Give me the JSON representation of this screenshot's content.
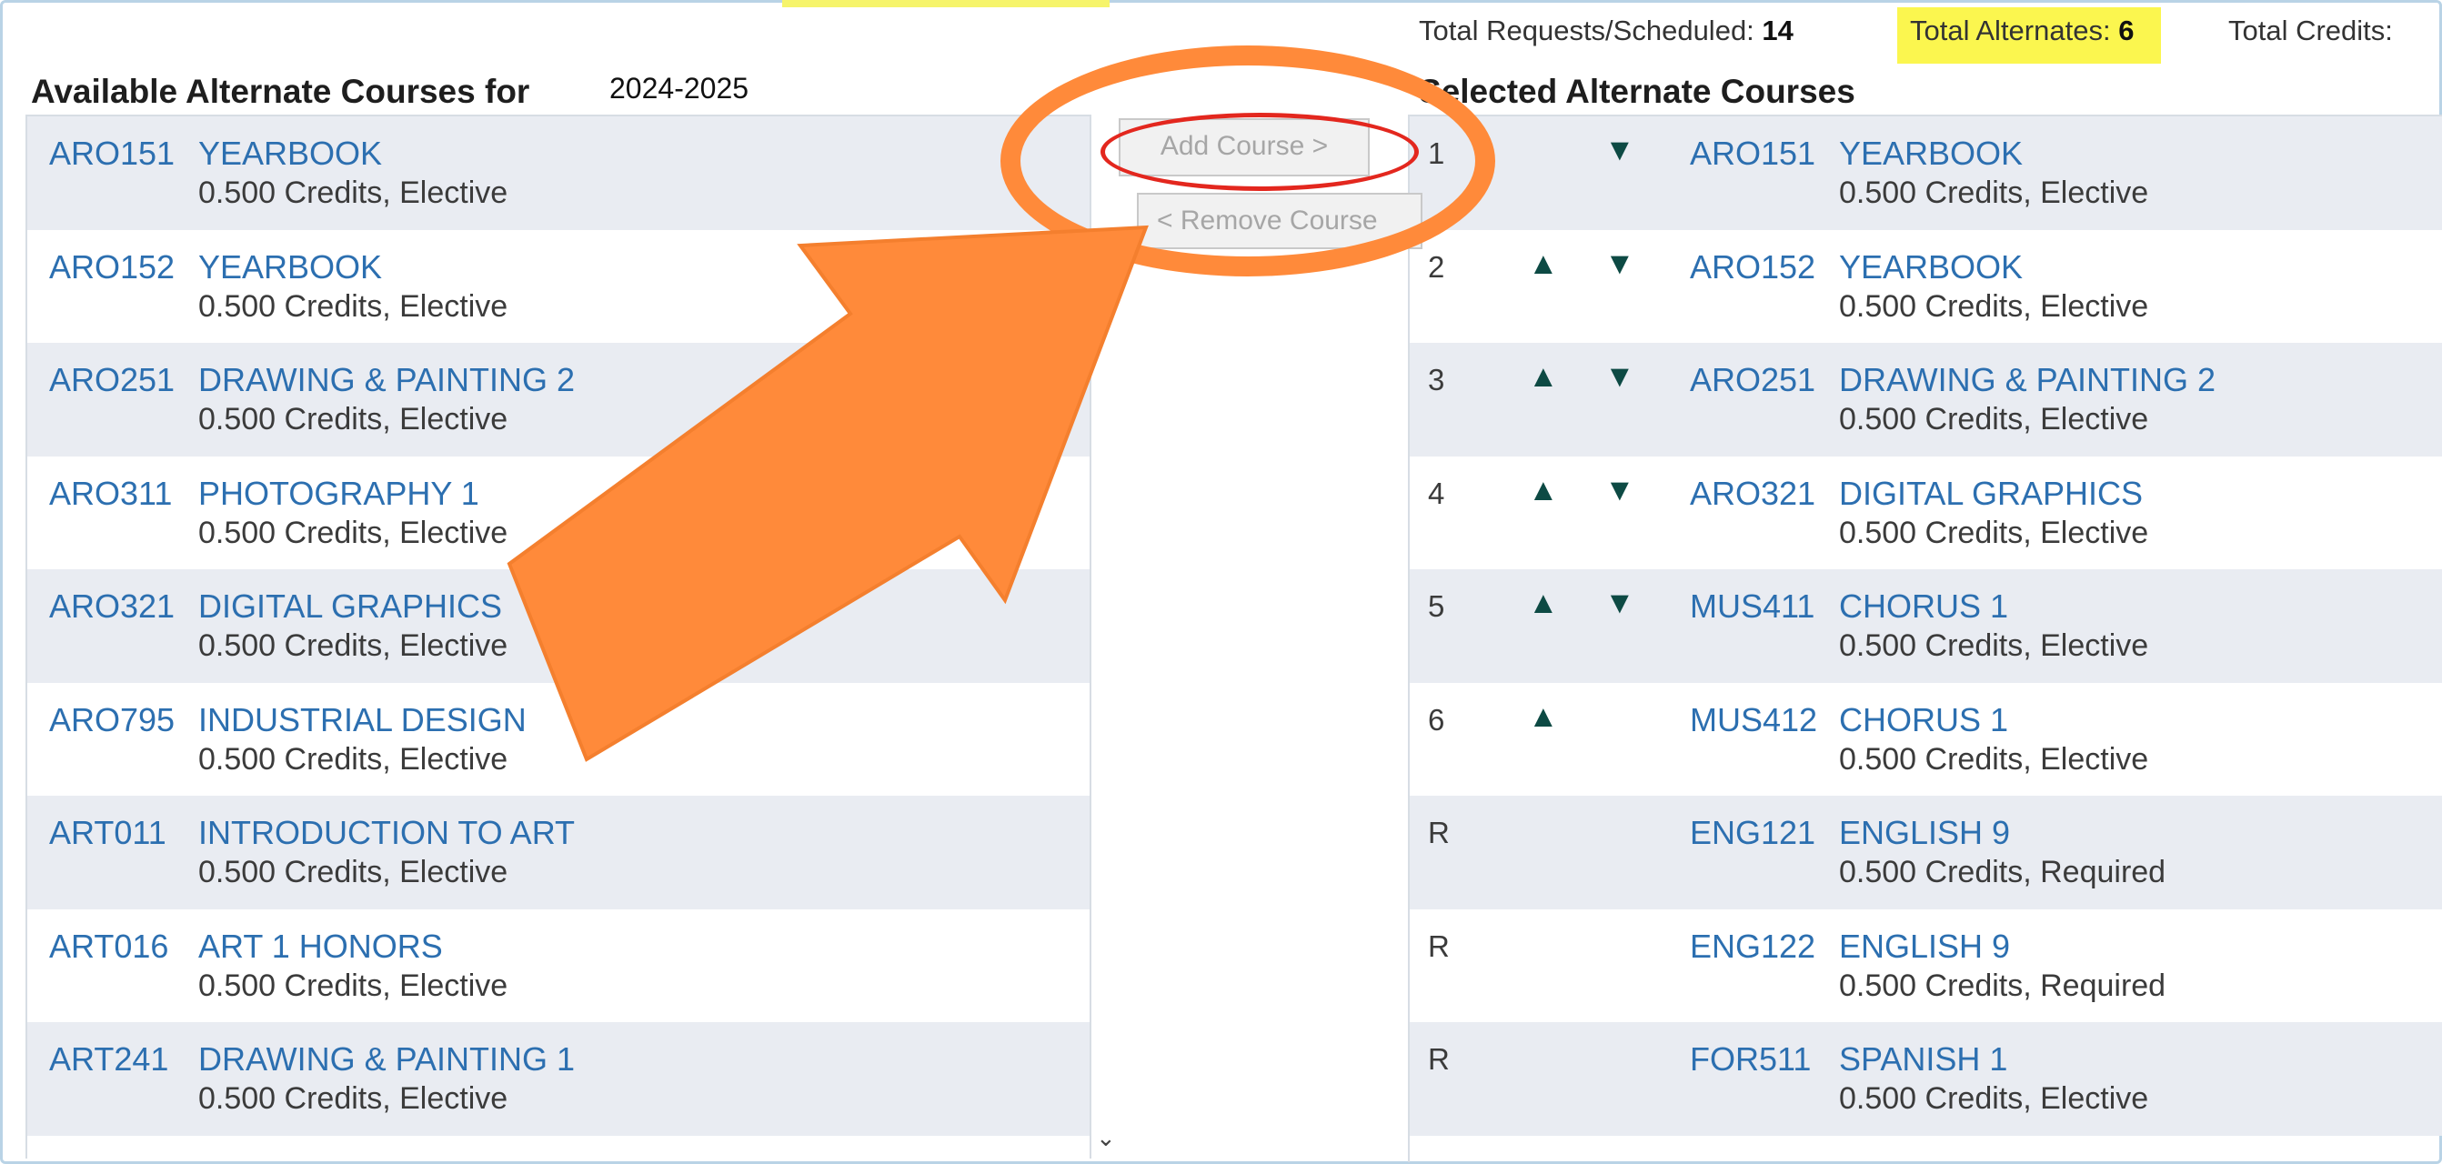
{
  "header": {
    "requests_label": "Total Requests/Scheduled:",
    "requests_value": "14",
    "alternates_label": "Total Alternates:",
    "alternates_value": "6",
    "credits_label": "Total Credits:"
  },
  "available": {
    "title": "Available Alternate Courses for",
    "year": "2024-2025",
    "courses": [
      {
        "code": "ARO151",
        "title": "YEARBOOK",
        "meta": "0.500 Credits,  Elective"
      },
      {
        "code": "ARO152",
        "title": "YEARBOOK",
        "meta": "0.500 Credits,  Elective"
      },
      {
        "code": "ARO251",
        "title": "DRAWING & PAINTING 2",
        "meta": "0.500 Credits,  Elective"
      },
      {
        "code": "ARO311",
        "title": "PHOTOGRAPHY 1",
        "meta": "0.500 Credits,  Elective"
      },
      {
        "code": "ARO321",
        "title": "DIGITAL GRAPHICS",
        "meta": "0.500 Credits,  Elective"
      },
      {
        "code": "ARO795",
        "title": "INDUSTRIAL DESIGN",
        "meta": "0.500 Credits,  Elective"
      },
      {
        "code": "ART011",
        "title": "INTRODUCTION TO ART",
        "meta": "0.500 Credits,  Elective"
      },
      {
        "code": "ART016",
        "title": "ART 1 HONORS",
        "meta": "0.500 Credits,  Elective"
      },
      {
        "code": "ART241",
        "title": "DRAWING & PAINTING 1",
        "meta": "0.500 Credits,  Elective"
      }
    ]
  },
  "actions": {
    "add_label": "Add Course >",
    "remove_label": "< Remove Course"
  },
  "selected": {
    "title": "Selected Alternate Courses",
    "courses": [
      {
        "num": "1",
        "code": "ARO151",
        "title": "YEARBOOK",
        "meta": "0.500 Credits,  Elective"
      },
      {
        "num": "2",
        "code": "ARO152",
        "title": "YEARBOOK",
        "meta": "0.500 Credits,  Elective"
      },
      {
        "num": "3",
        "code": "ARO251",
        "title": "DRAWING & PAINTING 2",
        "meta": "0.500 Credits,  Elective"
      },
      {
        "num": "4",
        "code": "ARO321",
        "title": "DIGITAL GRAPHICS",
        "meta": "0.500 Credits,  Elective"
      },
      {
        "num": "5",
        "code": "MUS411",
        "title": "CHORUS 1",
        "meta": "0.500 Credits,  Elective"
      },
      {
        "num": "6",
        "code": "MUS412",
        "title": "CHORUS 1",
        "meta": "0.500 Credits,  Elective"
      },
      {
        "num": "R",
        "code": "ENG121",
        "title": "ENGLISH 9",
        "meta": "0.500 Credits,  Required"
      },
      {
        "num": "R",
        "code": "ENG122",
        "title": "ENGLISH 9",
        "meta": "0.500 Credits,  Required"
      },
      {
        "num": "R",
        "code": "FOR511",
        "title": "SPANISH 1",
        "meta": "0.500 Credits,  Elective"
      }
    ]
  },
  "icons": {
    "up": "arrow-up-icon",
    "down": "arrow-down-icon",
    "scroll": "chevron-down-icon",
    "annotation": "annotation-arrow-icon"
  },
  "colors": {
    "link": "#2c6fb0",
    "highlight": "#fbf64f",
    "annotation": "#ff8a3a",
    "ring": "#e3271e"
  }
}
